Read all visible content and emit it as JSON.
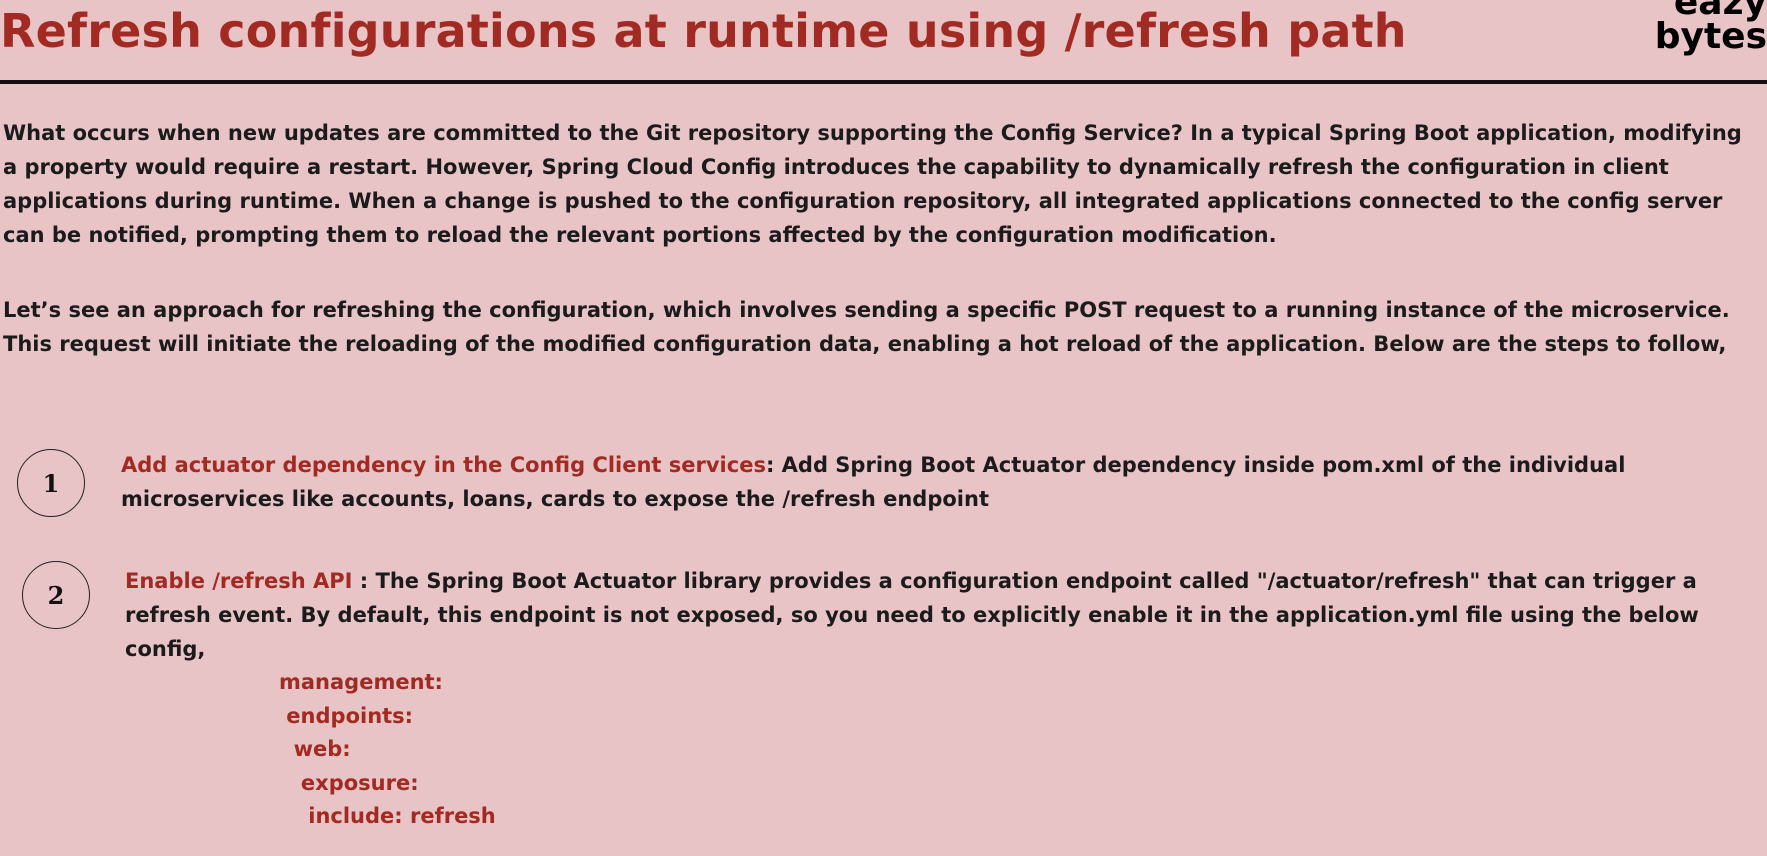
{
  "slide": {
    "title": "Refresh configurations at runtime using /refresh path",
    "logo": {
      "line1": "eazy",
      "line2": "bytes"
    },
    "paragraphs": [
      "What occurs when new updates are committed to the Git repository supporting the Config Service? In a typical Spring Boot application, modifying a property would require a restart. However, Spring Cloud Config introduces the capability to dynamically refresh the configuration in client applications during runtime. When a change is pushed to the configuration repository, all integrated applications connected to the config server can be notified, prompting them to reload the relevant portions affected by the configuration modification.",
      "Let’s see an approach for refreshing the configuration, which involves sending a specific POST request to a running instance of the microservice. This request will initiate the reloading of the modified configuration data, enabling a hot reload of the application. Below are the steps to follow,"
    ],
    "steps": [
      {
        "number": "1",
        "heading": "Add actuator dependency in the Config Client services",
        "separator": ":  ",
        "body": "Add Spring Boot Actuator dependency inside pom.xml of the individual microservices like accounts, loans, cards to expose the /refresh endpoint"
      },
      {
        "number": "2",
        "heading": "Enable /refresh API",
        "separator": " :  ",
        "body": "The Spring Boot Actuator library provides a configuration endpoint called \"/actuator/refresh\" that can trigger a refresh event. By default, this endpoint is not exposed, so you need to explicitly enable it in the application.yml file using the below config,"
      }
    ],
    "config_snippet": [
      "management:",
      " endpoints:",
      "  web:",
      "   exposure:",
      "    include: refresh"
    ]
  },
  "colors": {
    "background": "#e8c4c6",
    "accent": "#a12a22",
    "text": "#1b1b1b",
    "divider": "#111111"
  }
}
